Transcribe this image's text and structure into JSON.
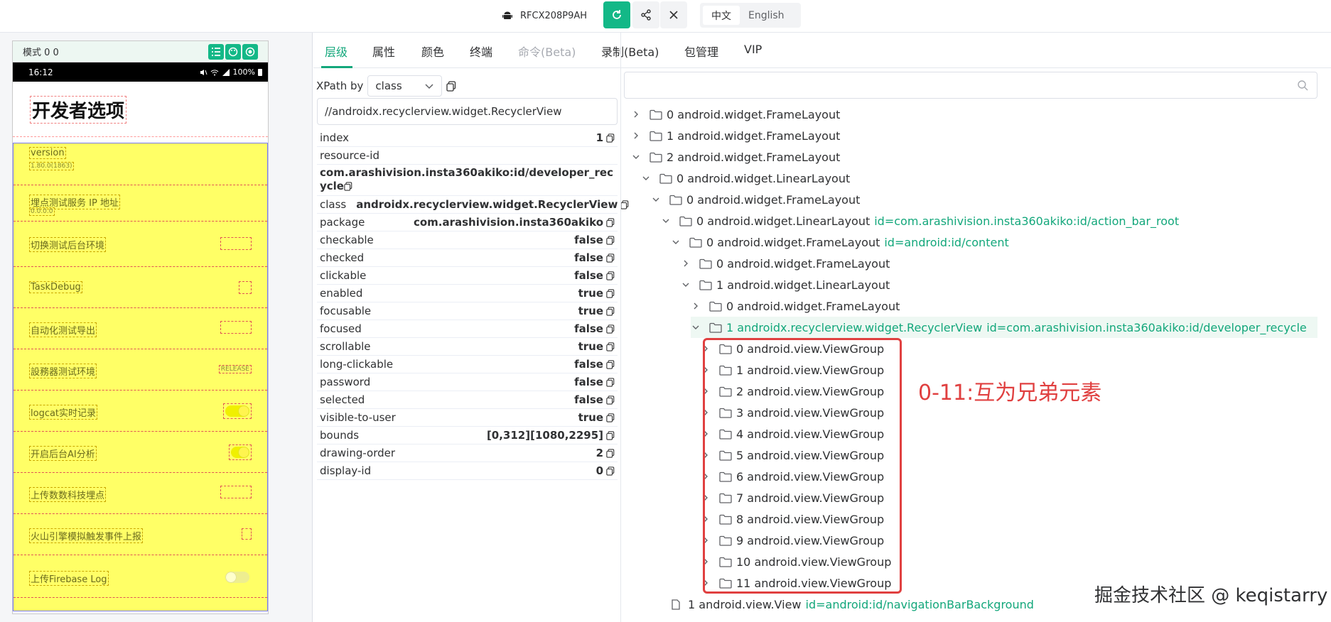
{
  "topbar": {
    "device_name": "RFCX208P9AH",
    "lang_options": [
      "中文",
      "English"
    ],
    "lang_selected": "中文"
  },
  "phone": {
    "toolbar_label": "模式 0 0",
    "status_time": "16:12",
    "status_battery": "100%",
    "screen_title": "开发者选项",
    "rows": [
      {
        "label": "version",
        "sub": "1.80.0(1863)"
      },
      {
        "label": "埋点测试服务 IP 地址",
        "sub": "0.0.0.0"
      },
      {
        "label": "切换测试后台环境"
      },
      {
        "label": "TaskDebug"
      },
      {
        "label": "自动化测试导出"
      },
      {
        "label": "設務器测试环境",
        "badge": "RELEASE"
      },
      {
        "label": "logcat实时记录",
        "toggle": "on"
      },
      {
        "label": "开启后台AI分析",
        "toggle": "on"
      },
      {
        "label": "上传数数科技埋点"
      },
      {
        "label": "火山引擎模拟触发事件上报"
      },
      {
        "label": "上传Firebase Log",
        "toggle": "off"
      }
    ]
  },
  "tabs": [
    {
      "label": "层级",
      "state": "active"
    },
    {
      "label": "属性",
      "state": "normal"
    },
    {
      "label": "颜色",
      "state": "normal"
    },
    {
      "label": "终端",
      "state": "normal"
    },
    {
      "label": "命令(Beta)",
      "state": "disabled"
    },
    {
      "label": "录制(Beta)",
      "state": "normal"
    },
    {
      "label": "包管理",
      "state": "normal"
    },
    {
      "label": "VIP",
      "state": "normal"
    }
  ],
  "xpath": {
    "label": "XPath by",
    "selected": "class",
    "value": "//androidx.recyclerview.widget.RecyclerView"
  },
  "props": [
    {
      "k": "index",
      "v": "1"
    },
    {
      "k": "resource-id",
      "v": ""
    },
    {
      "k": "",
      "v": "com.arashivision.insta360akiko:id/developer_recycle"
    },
    {
      "k": "class",
      "v": "androidx.recyclerview.widget.RecyclerView"
    },
    {
      "k": "package",
      "v": "com.arashivision.insta360akiko"
    },
    {
      "k": "checkable",
      "v": "false"
    },
    {
      "k": "checked",
      "v": "false"
    },
    {
      "k": "clickable",
      "v": "false"
    },
    {
      "k": "enabled",
      "v": "true"
    },
    {
      "k": "focusable",
      "v": "true"
    },
    {
      "k": "focused",
      "v": "false"
    },
    {
      "k": "scrollable",
      "v": "true"
    },
    {
      "k": "long-clickable",
      "v": "false"
    },
    {
      "k": "password",
      "v": "false"
    },
    {
      "k": "selected",
      "v": "false"
    },
    {
      "k": "visible-to-user",
      "v": "true"
    },
    {
      "k": "bounds",
      "v": "[0,312][1080,2295]"
    },
    {
      "k": "drawing-order",
      "v": "2"
    },
    {
      "k": "display-id",
      "v": "0"
    }
  ],
  "tree": [
    {
      "level": 0,
      "arrow": "right",
      "text": "0 android.widget.FrameLayout"
    },
    {
      "level": 0,
      "arrow": "right",
      "text": "1 android.widget.FrameLayout"
    },
    {
      "level": 0,
      "arrow": "down",
      "text": "2 android.widget.FrameLayout"
    },
    {
      "level": 1,
      "arrow": "down",
      "text": "0 android.widget.LinearLayout"
    },
    {
      "level": 2,
      "arrow": "down",
      "text": "0 android.widget.FrameLayout"
    },
    {
      "level": 3,
      "arrow": "down",
      "text": "0 android.widget.LinearLayout",
      "rid": "id=com.arashivision.insta360akiko:id/action_bar_root"
    },
    {
      "level": 4,
      "arrow": "down",
      "text": "0 android.widget.FrameLayout",
      "rid": "id=android:id/content"
    },
    {
      "level": 5,
      "arrow": "right",
      "text": "0 android.widget.FrameLayout"
    },
    {
      "level": 5,
      "arrow": "down",
      "text": "1 android.widget.LinearLayout"
    },
    {
      "level": 6,
      "arrow": "right",
      "text": "0 android.widget.FrameLayout"
    },
    {
      "level": 6,
      "arrow": "down",
      "text": "1 androidx.recyclerview.widget.RecyclerView",
      "rid": "id=com.arashivision.insta360akiko:id/developer_recycle",
      "selected": true
    },
    {
      "level": 7,
      "arrow": "right",
      "text": "0 android.view.ViewGroup"
    },
    {
      "level": 7,
      "arrow": "right",
      "text": "1 android.view.ViewGroup"
    },
    {
      "level": 7,
      "arrow": "right",
      "text": "2 android.view.ViewGroup"
    },
    {
      "level": 7,
      "arrow": "right",
      "text": "3 android.view.ViewGroup"
    },
    {
      "level": 7,
      "arrow": "right",
      "text": "4 android.view.ViewGroup"
    },
    {
      "level": 7,
      "arrow": "right",
      "text": "5 android.view.ViewGroup"
    },
    {
      "level": 7,
      "arrow": "right",
      "text": "6 android.view.ViewGroup"
    },
    {
      "level": 7,
      "arrow": "right",
      "text": "7 android.view.ViewGroup"
    },
    {
      "level": 7,
      "arrow": "right",
      "text": "8 android.view.ViewGroup"
    },
    {
      "level": 7,
      "arrow": "right",
      "text": "9 android.view.ViewGroup"
    },
    {
      "level": 7,
      "arrow": "right",
      "text": "10 android.view.ViewGroup"
    },
    {
      "level": 7,
      "arrow": "right",
      "text": "11 android.view.ViewGroup"
    },
    {
      "level": 2,
      "arrow": "none",
      "text": "1 android.view.View",
      "rid": "id=android:id/navigationBarBackground"
    }
  ],
  "annotation": "0-11:互为兄弟元素",
  "watermark": "掘金技术社区 @ keqistarry",
  "colors": {
    "accent": "#13b887",
    "annotation_red": "#e04040",
    "highlight_yellow": "#ffff66"
  }
}
